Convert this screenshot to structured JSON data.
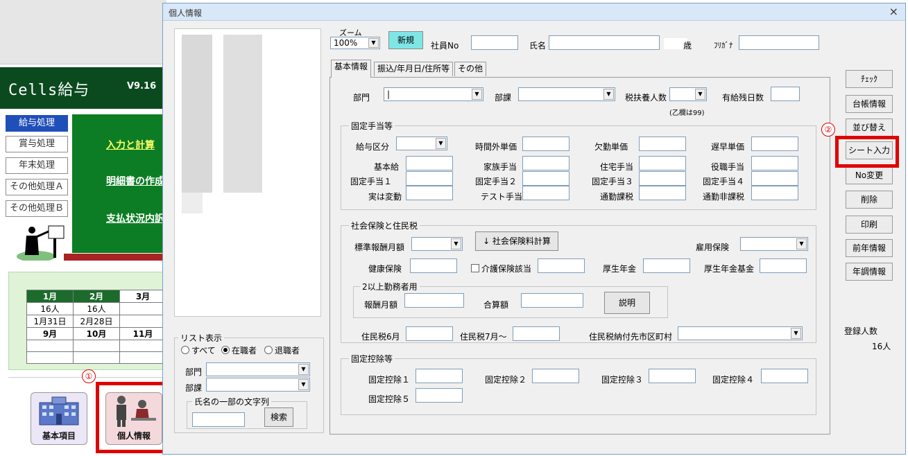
{
  "background_app": {
    "title": "Cells給与",
    "version": "V9.16",
    "menu": [
      "給与処理",
      "賞与処理",
      "年末処理",
      "その他処理Ａ",
      "その他処理Ｂ"
    ],
    "links": [
      "入力と計算",
      "明細書の作成",
      "支払状況内訳"
    ],
    "calendar": {
      "row1": [
        "1月",
        "2月",
        "3月"
      ],
      "row2": [
        "16人",
        "16人",
        ""
      ],
      "row3": [
        "1月31日",
        "2月28日",
        ""
      ],
      "row4": [
        "9月",
        "10月",
        "11月"
      ]
    },
    "icons": {
      "kihon": "基本項目",
      "kojin": "個人情報"
    },
    "markers": {
      "one": "①",
      "two": "②"
    }
  },
  "dialog": {
    "title": "個人情報",
    "close": "×",
    "zoom_label": "ズーム",
    "zoom_value": "100%",
    "new_button": "新規",
    "employee_no_label": "社員No",
    "name_label": "氏名",
    "age_unit": "歳",
    "furigana_label": "ﾌﾘｶﾞﾅ",
    "tabs": [
      "基本情報",
      "振込/年月日/住所等",
      "その他"
    ],
    "basic": {
      "bumon": "部門",
      "buka": "部課",
      "fuyou": "税扶養人数",
      "fuyou_note": "(乙欄は99)",
      "yukyu": "有給残日数",
      "group_fixed": "固定手当等",
      "kyuyo_kubun": "給与区分",
      "jikangai": "時間外単価",
      "kekkin": "欠勤単価",
      "chikoku": "遅早単価",
      "kihonkyu": "基本給",
      "kazoku": "家族手当",
      "jutaku": "住宅手当",
      "yakushoku": "役職手当",
      "kotei1": "固定手当１",
      "kotei2": "固定手当２",
      "kotei3": "固定手当３",
      "kotei4": "固定手当４",
      "jitsu": "実は変動",
      "test": "テスト手当",
      "tsukin_kazei": "通勤課税",
      "tsukin_hikazei": "通勤非課税",
      "group_social": "社会保険と住民税",
      "hyojun": "標準報酬月額",
      "calc_button": "↓ 社会保険料計算",
      "koyo": "雇用保険",
      "kenko": "健康保険",
      "kaigo": "介護保険該当",
      "kosei": "厚生年金",
      "kosei_kikin": "厚生年金基金",
      "group_multi": "2以上勤務者用",
      "hoshu": "報酬月額",
      "gokei": "合算額",
      "setsumei": "説明",
      "jumin6": "住民税6月",
      "jumin7": "住民税7月～",
      "jumin_shi": "住民税納付先市区町村",
      "group_deduct": "固定控除等",
      "koujo1": "固定控除１",
      "koujo2": "固定控除２",
      "koujo3": "固定控除３",
      "koujo4": "固定控除４",
      "koujo5": "固定控除５"
    },
    "list_filter": {
      "group": "リスト表示",
      "all": "すべて",
      "current": "在職者",
      "retired": "退職者",
      "bumon": "部門",
      "buka": "部課",
      "name_group": "氏名の一部の文字列",
      "search": "検索"
    },
    "right_buttons": [
      "ﾁｪｯｸ",
      "台帳情報",
      "並び替え",
      "シート入力",
      "No変更",
      "削除",
      "印刷",
      "前年情報",
      "年調情報"
    ],
    "registered_label": "登録人数",
    "registered_count": "16人"
  }
}
